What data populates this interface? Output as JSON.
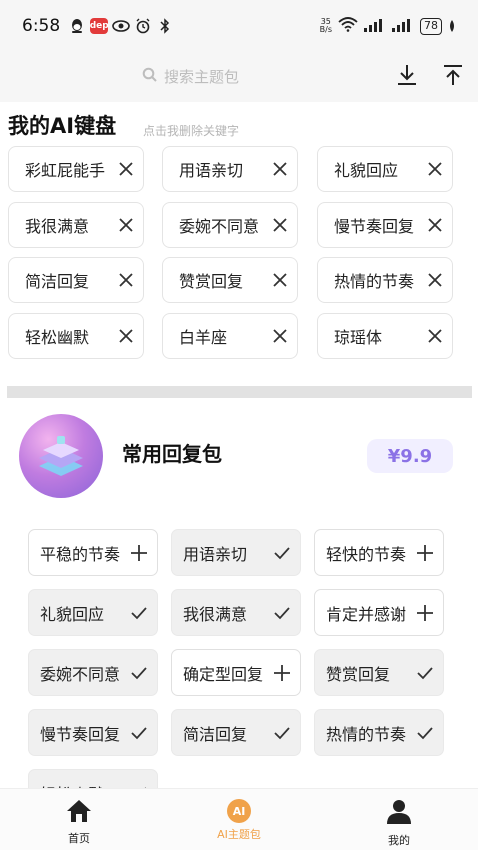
{
  "status_bar": {
    "time": "6:58",
    "net_speed_top": "35",
    "net_speed_bottom": "B/s",
    "battery": "78",
    "icons": [
      "qq-icon",
      "app-badge-icon",
      "eye-icon",
      "alarm-icon",
      "bluetooth-icon",
      "wifi-icon",
      "signal-icon",
      "signal-icon",
      "battery-icon",
      "leaf-icon"
    ],
    "app_badge_text": "dep"
  },
  "header": {
    "search_placeholder": "搜索主题包",
    "icons": [
      "search-icon",
      "download-icon",
      "scroll-top-icon"
    ]
  },
  "keyboard": {
    "title": "我的AI键盘",
    "hint": "点击我删除关键字",
    "keywords": [
      "彩虹屁能手",
      "用语亲切",
      "礼貌回应",
      "我很满意",
      "委婉不同意",
      "慢节奏回复",
      "简洁回复",
      "赞赏回复",
      "热情的节奏",
      "轻松幽默",
      "白羊座",
      "琼瑶体"
    ]
  },
  "package": {
    "title": "常用回复包",
    "price": "¥9.9",
    "accent_color": "#8b72e6",
    "phrases": [
      {
        "label": "平稳的节奏",
        "added": false
      },
      {
        "label": "用语亲切",
        "added": true
      },
      {
        "label": "轻快的节奏",
        "added": false
      },
      {
        "label": "礼貌回应",
        "added": true
      },
      {
        "label": "我很满意",
        "added": true
      },
      {
        "label": "肯定并感谢",
        "added": false
      },
      {
        "label": "委婉不同意",
        "added": true
      },
      {
        "label": "确定型回复",
        "added": false
      },
      {
        "label": "赞赏回复",
        "added": true
      },
      {
        "label": "慢节奏回复",
        "added": true
      },
      {
        "label": "简洁回复",
        "added": true
      },
      {
        "label": "热情的节奏",
        "added": true
      },
      {
        "label": "轻松幽默",
        "added": true
      }
    ]
  },
  "bottom_nav": {
    "items": [
      {
        "label": "首页",
        "icon": "home-icon",
        "active": false
      },
      {
        "label": "AI主题包",
        "icon": "ai-icon",
        "active": true,
        "icon_text": "AI"
      },
      {
        "label": "我的",
        "icon": "user-icon",
        "active": false
      }
    ],
    "active_color": "#f0a24a"
  }
}
